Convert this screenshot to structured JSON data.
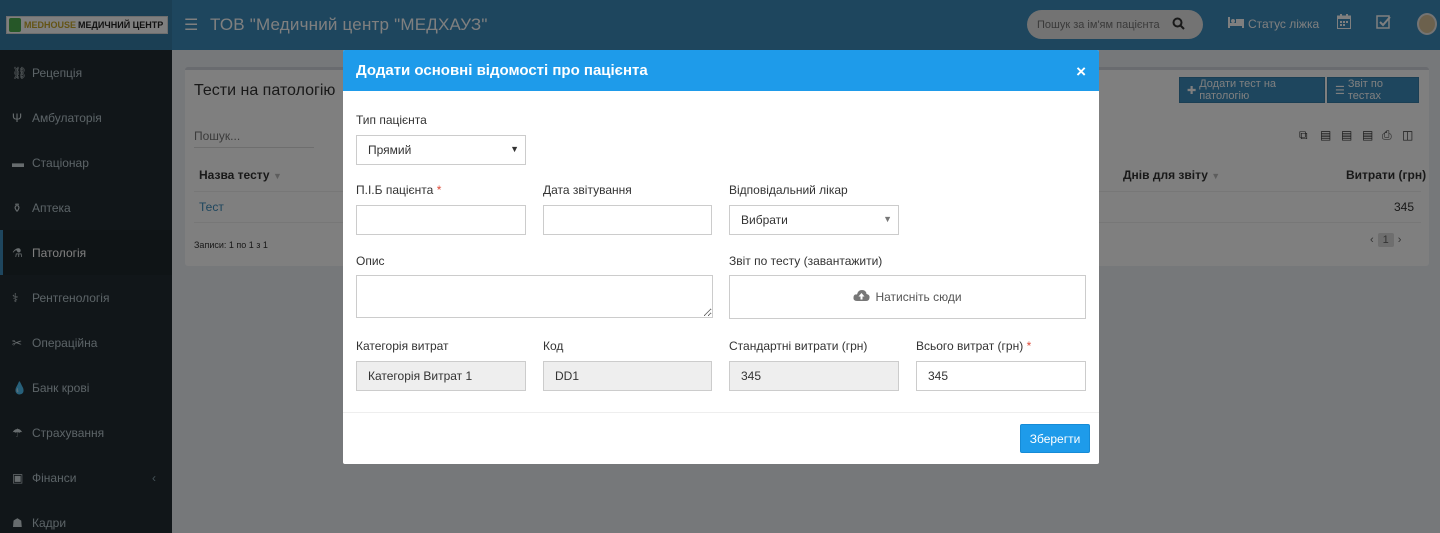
{
  "header": {
    "logo_brand": "MEDHOUSE",
    "logo_text": "МЕДИЧНИЙ ЦЕНТР",
    "menu_icon": "☰",
    "title": "ТОВ \"Медичний центр \"МЕДХАУЗ\"",
    "search_placeholder": "Пошук за ім'ям пацієнта",
    "search_icon": "search-icon",
    "bed_status_label": "Статус ліжка",
    "icons": [
      "bed-icon",
      "calendar-icon",
      "checkbox-icon",
      "user-avatar-icon"
    ]
  },
  "sidebar": {
    "items": [
      {
        "label": "Рецепція",
        "icon": "sitemap-icon",
        "glyph": "⛓"
      },
      {
        "label": "Амбулаторія",
        "icon": "stethoscope-icon",
        "glyph": "Ψ"
      },
      {
        "label": "Стаціонар",
        "icon": "bed-icon",
        "glyph": "▬"
      },
      {
        "label": "Аптека",
        "icon": "pestle-icon",
        "glyph": "⚱"
      },
      {
        "label": "Патологія",
        "icon": "flask-icon",
        "glyph": "⚗"
      },
      {
        "label": "Рентгенологія",
        "icon": "xray-icon",
        "glyph": "⚕"
      },
      {
        "label": "Операційна",
        "icon": "scissors-icon",
        "glyph": "✂"
      },
      {
        "label": "Банк крові",
        "icon": "drop-icon",
        "glyph": "💧"
      },
      {
        "label": "Страхування",
        "icon": "umbrella-icon",
        "glyph": "☂"
      },
      {
        "label": "Фінанси",
        "icon": "money-icon",
        "glyph": "▣"
      },
      {
        "label": "Кадри",
        "icon": "users-icon",
        "glyph": "☗"
      }
    ],
    "active_item": "Патологія"
  },
  "page": {
    "title": "Тести на патологію",
    "add_button": "Додати тест на патологію",
    "report_button": "Звіт по тестах",
    "search_placeholder": "Пошук...",
    "table": {
      "columns": [
        "Назва тесту",
        "Днів для звіту",
        "Витрати (грн)"
      ],
      "rows": [
        {
          "name": "Тест",
          "cost": "345"
        }
      ]
    },
    "records_info": "Записи: 1 по 1 з 1",
    "pagination": {
      "prev": "‹",
      "current": "1",
      "next": "›"
    }
  },
  "modal": {
    "title": "Додати основні відомості про пацієнта",
    "close": "×",
    "patient_type_label": "Тип пацієнта",
    "patient_type_value": "Прямий",
    "patient_name_label": "П.І.Б пацієнта",
    "report_date_label": "Дата звітування",
    "doctor_label": "Відповідальний лікар",
    "doctor_value": "Вибрати",
    "description_label": "Опис",
    "upload_label": "Звіт по тесту (завантажити)",
    "upload_button": "Натисніть сюди",
    "category_label": "Категорія витрат",
    "category_value": "Категорія Витрат 1",
    "code_label": "Код",
    "code_value": "DD1",
    "standard_cost_label": "Стандартні витрати (грн)",
    "standard_cost_value": "345",
    "total_cost_label": "Всього витрат (грн)",
    "total_cost_value": "345",
    "save_button": "Зберегти",
    "required_mark": "*"
  },
  "colors": {
    "primary": "#3c8dbc",
    "modal_header": "#1e9bea",
    "sidebar": "#222d32",
    "required": "#dd4b39"
  }
}
